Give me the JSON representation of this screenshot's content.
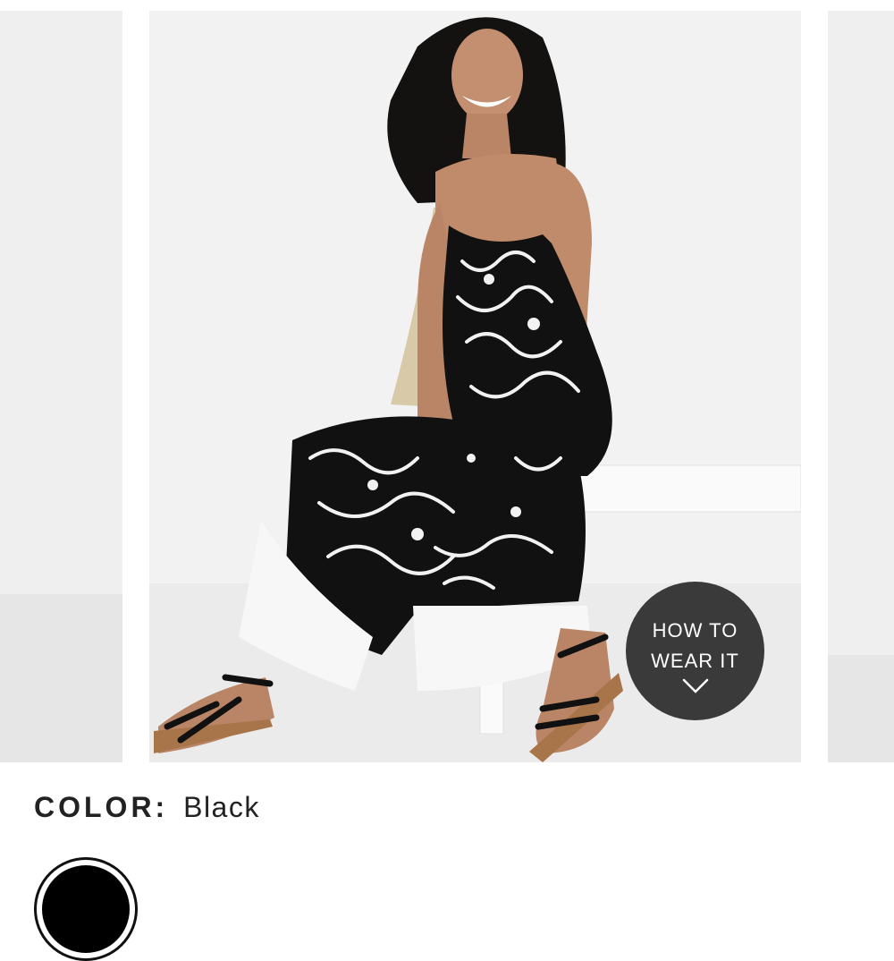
{
  "product": {
    "how_to_wear_label": "HOW TO\nWEAR IT",
    "color_label": "COLOR:",
    "color_value": "Black",
    "swatch_color": "#000000"
  },
  "gallery": {
    "slides": [
      "prev-slide",
      "main-slide",
      "next-slide"
    ],
    "main_image": "model seated on white bench wearing black and white floral print wide-leg jumpsuit"
  },
  "icons": {
    "how_to_wear": "chevron-down-icon"
  }
}
